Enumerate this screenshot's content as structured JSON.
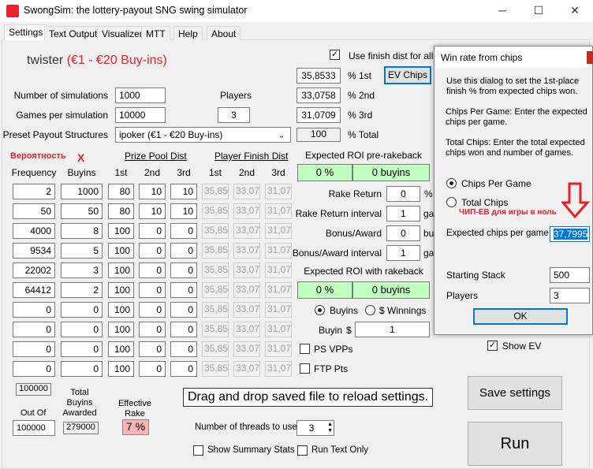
{
  "window": {
    "title": "SwongSim: the lottery-payout SNG swing simulator",
    "min": "─",
    "max": "☐",
    "close": "✕"
  },
  "tabs": [
    "Settings",
    "Text Output",
    "Visualizer",
    "MTT",
    "Help",
    "About"
  ],
  "settings": {
    "name": "twister",
    "name_paren": "(€1 - €20 Buy-ins)",
    "num_sims_label": "Number of simulations",
    "num_sims": "1000",
    "games_label": "Games per simulation",
    "games": "10000",
    "players_label": "Players",
    "players": "3",
    "preset_label": "Preset Payout Structures",
    "preset": "ipoker (€1 - €20 Buy-ins)",
    "annot_prob": "Вероятность",
    "annot_x": "X",
    "prize_pool_dist": "Prize Pool Dist",
    "player_finish_dist": "Player Finish Dist",
    "col_headers": [
      "Frequency",
      "Buyins",
      "1st",
      "2nd",
      "3rd",
      "1st",
      "2nd",
      "3rd"
    ],
    "rows": [
      [
        "2",
        "1000",
        "80",
        "10",
        "10",
        "35,85",
        "33,07",
        "31,07"
      ],
      [
        "50",
        "50",
        "80",
        "10",
        "10",
        "35,85",
        "33,07",
        "31,07"
      ],
      [
        "4000",
        "8",
        "100",
        "0",
        "0",
        "35,85",
        "33,07",
        "31,07"
      ],
      [
        "9534",
        "5",
        "100",
        "0",
        "0",
        "35,85",
        "33,07",
        "31,07"
      ],
      [
        "22002",
        "3",
        "100",
        "0",
        "0",
        "35,85",
        "33,07",
        "31,07"
      ],
      [
        "64412",
        "2",
        "100",
        "0",
        "0",
        "35,85",
        "33,07",
        "31,07"
      ],
      [
        "0",
        "0",
        "100",
        "0",
        "0",
        "35,85",
        "33,07",
        "31,07"
      ],
      [
        "0",
        "0",
        "100",
        "0",
        "0",
        "35,85",
        "33,07",
        "31,07"
      ],
      [
        "0",
        "0",
        "100",
        "0",
        "0",
        "35,85",
        "33,07",
        "31,07"
      ],
      [
        "0",
        "0",
        "100",
        "0",
        "0",
        "35,85",
        "33,07",
        "31,07"
      ]
    ],
    "freq_total": "100000",
    "out_of_label": "Out Of",
    "out_of": "100000",
    "total_buyins_label": "Total Buyins Awarded",
    "total_buyins": "279000",
    "eff_rake_label": "Effective Rake",
    "eff_rake": "7 %",
    "use_finish_dist": "Use finish dist for all",
    "pct1": "35,8533",
    "pct1_label": "% 1st",
    "pct2": "33,0758",
    "pct2_label": "% 2nd",
    "pct3": "31,0709",
    "pct3_label": "% 3rd",
    "total": "100",
    "total_label": "% Total",
    "ev_chips": "EV Chips",
    "roi_pre_label": "Expected ROI pre-rakeback",
    "roi_pre_pct": "0 %",
    "roi_pre_bi": "0 buyins",
    "rake_return_label": "Rake Return",
    "rake_return": "0",
    "rake_return_unit": "%",
    "rake_interval_label": "Rake Return interval",
    "rake_interval": "1",
    "rake_interval_unit": "ga",
    "bonus_label": "Bonus/Award",
    "bonus": "0",
    "bonus_unit": "bu",
    "bonus_interval_label": "Bonus/Award interval",
    "bonus_interval": "1",
    "bonus_interval_unit": "ga",
    "roi_rb_label": "Expected ROI with rakeback",
    "roi_rb_pct": "0 %",
    "roi_rb_bi": "0 buyins",
    "radio_buyins": "Buyins",
    "radio_winnings": "$ Winnings",
    "buyin_label": "Buyin",
    "buyin_currency": "$",
    "buyin": "1",
    "ps_vpps": "PS VPPs",
    "ftp_pts": "FTP Pts",
    "show_ev": "Show EV",
    "drag_drop": "Drag and drop saved file to reload settings.",
    "threads_label": "Number of threads to use",
    "threads": "3",
    "show_summary": "Show Summary Stats",
    "run_text_only": "Run Text Only",
    "save_settings": "Save settings",
    "run": "Run"
  },
  "dialog": {
    "title": "Win rate from chips",
    "desc1": "Use this dialog to set the 1st-place finish % from expected chips won.",
    "desc2": "Chips Per Game:  Enter the expected chips per game.",
    "desc3": "Total Chips:  Enter the total expected chips won and number of games.",
    "radio_cpg": "Chips Per Game",
    "radio_total": "Total Chips",
    "annot": "ЧИП-ЕВ для игры в ноль",
    "exp_chips_label": "Expected chips per game",
    "exp_chips": "37,7995",
    "stack_label": "Starting Stack",
    "stack": "500",
    "players_label": "Players",
    "players": "3",
    "ok": "OK"
  },
  "colors": {
    "accent_red": "#e8202a",
    "roi_green": "#c0ffc0",
    "rake_pink": "#ffb4b4",
    "focus_blue": "#0078d7"
  }
}
